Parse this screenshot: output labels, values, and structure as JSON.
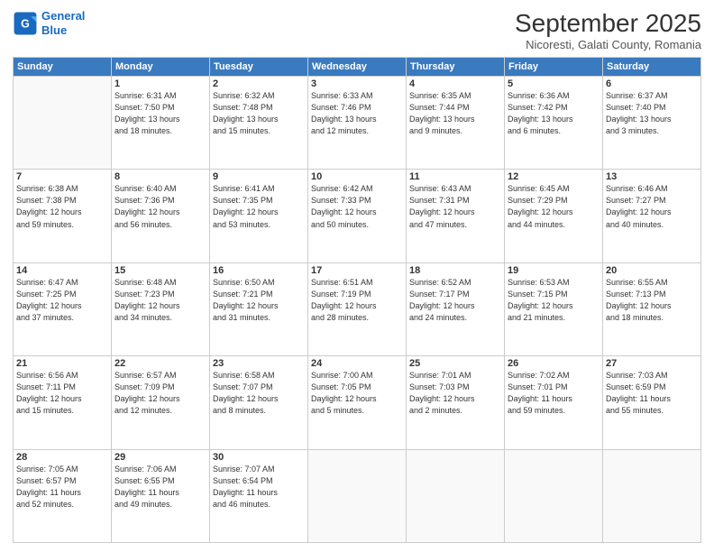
{
  "logo": {
    "line1": "General",
    "line2": "Blue"
  },
  "title": "September 2025",
  "subtitle": "Nicoresti, Galati County, Romania",
  "days_header": [
    "Sunday",
    "Monday",
    "Tuesday",
    "Wednesday",
    "Thursday",
    "Friday",
    "Saturday"
  ],
  "weeks": [
    [
      {
        "day": "",
        "detail": ""
      },
      {
        "day": "1",
        "detail": "Sunrise: 6:31 AM\nSunset: 7:50 PM\nDaylight: 13 hours\nand 18 minutes."
      },
      {
        "day": "2",
        "detail": "Sunrise: 6:32 AM\nSunset: 7:48 PM\nDaylight: 13 hours\nand 15 minutes."
      },
      {
        "day": "3",
        "detail": "Sunrise: 6:33 AM\nSunset: 7:46 PM\nDaylight: 13 hours\nand 12 minutes."
      },
      {
        "day": "4",
        "detail": "Sunrise: 6:35 AM\nSunset: 7:44 PM\nDaylight: 13 hours\nand 9 minutes."
      },
      {
        "day": "5",
        "detail": "Sunrise: 6:36 AM\nSunset: 7:42 PM\nDaylight: 13 hours\nand 6 minutes."
      },
      {
        "day": "6",
        "detail": "Sunrise: 6:37 AM\nSunset: 7:40 PM\nDaylight: 13 hours\nand 3 minutes."
      }
    ],
    [
      {
        "day": "7",
        "detail": "Sunrise: 6:38 AM\nSunset: 7:38 PM\nDaylight: 12 hours\nand 59 minutes."
      },
      {
        "day": "8",
        "detail": "Sunrise: 6:40 AM\nSunset: 7:36 PM\nDaylight: 12 hours\nand 56 minutes."
      },
      {
        "day": "9",
        "detail": "Sunrise: 6:41 AM\nSunset: 7:35 PM\nDaylight: 12 hours\nand 53 minutes."
      },
      {
        "day": "10",
        "detail": "Sunrise: 6:42 AM\nSunset: 7:33 PM\nDaylight: 12 hours\nand 50 minutes."
      },
      {
        "day": "11",
        "detail": "Sunrise: 6:43 AM\nSunset: 7:31 PM\nDaylight: 12 hours\nand 47 minutes."
      },
      {
        "day": "12",
        "detail": "Sunrise: 6:45 AM\nSunset: 7:29 PM\nDaylight: 12 hours\nand 44 minutes."
      },
      {
        "day": "13",
        "detail": "Sunrise: 6:46 AM\nSunset: 7:27 PM\nDaylight: 12 hours\nand 40 minutes."
      }
    ],
    [
      {
        "day": "14",
        "detail": "Sunrise: 6:47 AM\nSunset: 7:25 PM\nDaylight: 12 hours\nand 37 minutes."
      },
      {
        "day": "15",
        "detail": "Sunrise: 6:48 AM\nSunset: 7:23 PM\nDaylight: 12 hours\nand 34 minutes."
      },
      {
        "day": "16",
        "detail": "Sunrise: 6:50 AM\nSunset: 7:21 PM\nDaylight: 12 hours\nand 31 minutes."
      },
      {
        "day": "17",
        "detail": "Sunrise: 6:51 AM\nSunset: 7:19 PM\nDaylight: 12 hours\nand 28 minutes."
      },
      {
        "day": "18",
        "detail": "Sunrise: 6:52 AM\nSunset: 7:17 PM\nDaylight: 12 hours\nand 24 minutes."
      },
      {
        "day": "19",
        "detail": "Sunrise: 6:53 AM\nSunset: 7:15 PM\nDaylight: 12 hours\nand 21 minutes."
      },
      {
        "day": "20",
        "detail": "Sunrise: 6:55 AM\nSunset: 7:13 PM\nDaylight: 12 hours\nand 18 minutes."
      }
    ],
    [
      {
        "day": "21",
        "detail": "Sunrise: 6:56 AM\nSunset: 7:11 PM\nDaylight: 12 hours\nand 15 minutes."
      },
      {
        "day": "22",
        "detail": "Sunrise: 6:57 AM\nSunset: 7:09 PM\nDaylight: 12 hours\nand 12 minutes."
      },
      {
        "day": "23",
        "detail": "Sunrise: 6:58 AM\nSunset: 7:07 PM\nDaylight: 12 hours\nand 8 minutes."
      },
      {
        "day": "24",
        "detail": "Sunrise: 7:00 AM\nSunset: 7:05 PM\nDaylight: 12 hours\nand 5 minutes."
      },
      {
        "day": "25",
        "detail": "Sunrise: 7:01 AM\nSunset: 7:03 PM\nDaylight: 12 hours\nand 2 minutes."
      },
      {
        "day": "26",
        "detail": "Sunrise: 7:02 AM\nSunset: 7:01 PM\nDaylight: 11 hours\nand 59 minutes."
      },
      {
        "day": "27",
        "detail": "Sunrise: 7:03 AM\nSunset: 6:59 PM\nDaylight: 11 hours\nand 55 minutes."
      }
    ],
    [
      {
        "day": "28",
        "detail": "Sunrise: 7:05 AM\nSunset: 6:57 PM\nDaylight: 11 hours\nand 52 minutes."
      },
      {
        "day": "29",
        "detail": "Sunrise: 7:06 AM\nSunset: 6:55 PM\nDaylight: 11 hours\nand 49 minutes."
      },
      {
        "day": "30",
        "detail": "Sunrise: 7:07 AM\nSunset: 6:54 PM\nDaylight: 11 hours\nand 46 minutes."
      },
      {
        "day": "",
        "detail": ""
      },
      {
        "day": "",
        "detail": ""
      },
      {
        "day": "",
        "detail": ""
      },
      {
        "day": "",
        "detail": ""
      }
    ]
  ]
}
